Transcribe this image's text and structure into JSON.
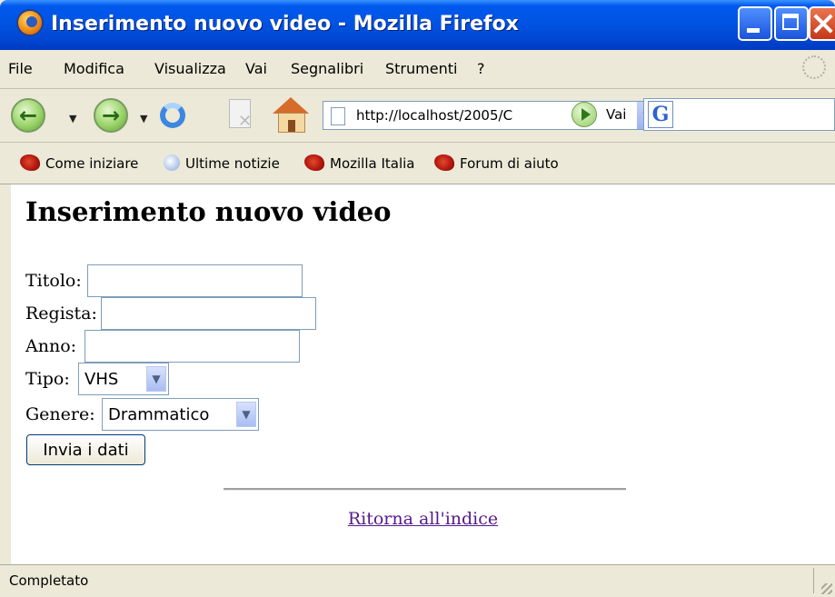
{
  "window": {
    "title": "Inserimento nuovo video - Mozilla Firefox"
  },
  "menu": {
    "items": [
      "File",
      "Modifica",
      "Visualizza",
      "Vai",
      "Segnalibri",
      "Strumenti",
      "?"
    ]
  },
  "toolbar": {
    "url": "http://localhost/2005/C",
    "go_label": "Vai",
    "search_engine": "G"
  },
  "bookmarks": {
    "items": [
      "Come iniziare",
      "Ultime notizie",
      "Mozilla Italia",
      "Forum di aiuto"
    ]
  },
  "page": {
    "heading": "Inserimento nuovo video",
    "fields": {
      "titolo_label": "Titolo:",
      "titolo_value": "",
      "regista_label": "Regista:",
      "regista_value": "",
      "anno_label": "Anno:",
      "anno_value": "",
      "tipo_label": "Tipo:",
      "tipo_selected": "VHS",
      "genere_label": "Genere:",
      "genere_selected": "Drammatico"
    },
    "submit_label": "Invia i dati",
    "back_link": "Ritorna all'indice"
  },
  "status": {
    "text": "Completato"
  },
  "colors": {
    "titlebar": "#0054e3",
    "chrome": "#ece9d8",
    "link_visited": "#551a8b",
    "input_border": "#7f9db9"
  }
}
